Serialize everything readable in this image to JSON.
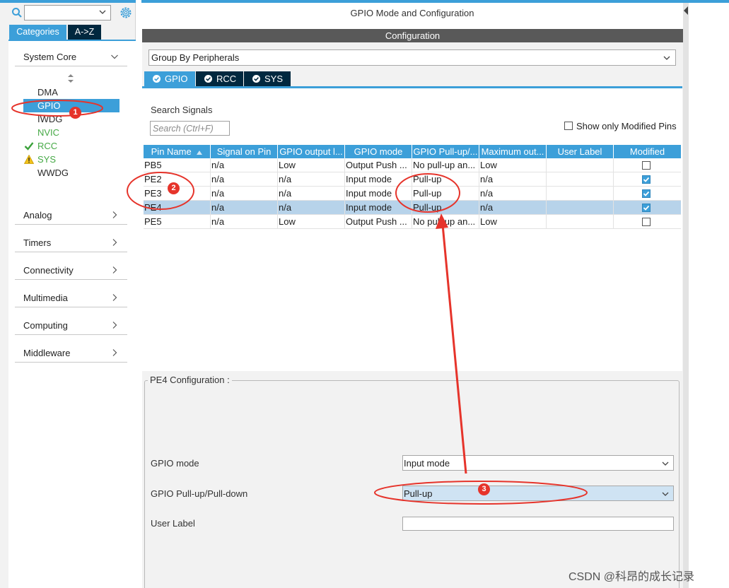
{
  "left_panel": {
    "search_value": "",
    "tabs": {
      "categories": "Categories",
      "az": "A->Z"
    },
    "system_core": {
      "label": "System Core",
      "items": [
        {
          "label": "DMA",
          "status": "none"
        },
        {
          "label": "GPIO",
          "status": "selected"
        },
        {
          "label": "IWDG",
          "status": "none"
        },
        {
          "label": "NVIC",
          "status": "green"
        },
        {
          "label": "RCC",
          "status": "check"
        },
        {
          "label": "SYS",
          "status": "warning"
        },
        {
          "label": "WWDG",
          "status": "none"
        }
      ]
    },
    "categories": [
      "Analog",
      "Timers",
      "Connectivity",
      "Multimedia",
      "Computing",
      "Middleware"
    ]
  },
  "main": {
    "title": "GPIO Mode and Configuration",
    "config_bar": "Configuration",
    "group_select": "Group By Peripherals",
    "peripheral_tabs": [
      "GPIO",
      "RCC",
      "SYS"
    ],
    "search_signals_label": "Search Signals",
    "search_placeholder": "Search (Ctrl+F)",
    "show_modified_label": "Show only Modified Pins",
    "table": {
      "headers": [
        "Pin Name",
        "Signal on Pin",
        "GPIO output l...",
        "GPIO mode",
        "GPIO Pull-up/...",
        "Maximum out...",
        "User Label",
        "Modified"
      ],
      "rows": [
        {
          "pin": "PB5",
          "signal": "n/a",
          "output": "Low",
          "mode": "Output Push ...",
          "pull": "No pull-up an...",
          "max": "Low",
          "label": "",
          "modified": false
        },
        {
          "pin": "PE2",
          "signal": "n/a",
          "output": "n/a",
          "mode": "Input mode",
          "pull": "Pull-up",
          "max": "n/a",
          "label": "",
          "modified": true
        },
        {
          "pin": "PE3",
          "signal": "n/a",
          "output": "n/a",
          "mode": "Input mode",
          "pull": "Pull-up",
          "max": "n/a",
          "label": "",
          "modified": true
        },
        {
          "pin": "PE4",
          "signal": "n/a",
          "output": "n/a",
          "mode": "Input mode",
          "pull": "Pull-up",
          "max": "n/a",
          "label": "",
          "modified": true,
          "selected": true
        },
        {
          "pin": "PE5",
          "signal": "n/a",
          "output": "Low",
          "mode": "Output Push ...",
          "pull": "No pull-up an...",
          "max": "Low",
          "label": "",
          "modified": false
        }
      ]
    },
    "pe4_config": {
      "legend": "PE4 Configuration :",
      "gpio_mode_label": "GPIO mode",
      "gpio_mode_value": "Input mode",
      "pull_label": "GPIO Pull-up/Pull-down",
      "pull_value": "Pull-up",
      "user_label_label": "User Label",
      "user_label_value": ""
    }
  },
  "annotations": {
    "badges": [
      "1",
      "2",
      "3"
    ],
    "color": "#e6342b"
  },
  "watermark": "CSDN @科昂的成长记录",
  "colors": {
    "accent": "#3c9fd9",
    "dark_tab": "#01283f",
    "selected_row": "#b7d3ea"
  }
}
